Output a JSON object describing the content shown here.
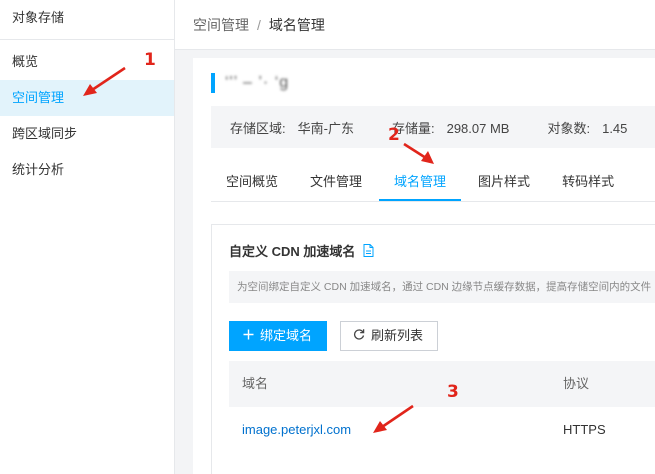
{
  "sidebar": {
    "title": "对象存储",
    "items": [
      {
        "label": "概览"
      },
      {
        "label": "空间管理"
      },
      {
        "label": "跨区域同步"
      },
      {
        "label": "统计分析"
      }
    ]
  },
  "breadcrumb": {
    "parent": "空间管理",
    "separator": "/",
    "current": "域名管理"
  },
  "bucket": {
    "name": "‘'’ – ’· ‘g"
  },
  "stats": {
    "region_label": "存储区域:",
    "region_value": "华南-广东",
    "storage_label": "存储量:",
    "storage_value": "298.07 MB",
    "objects_label": "对象数:",
    "objects_value": "1.45"
  },
  "tabs": [
    {
      "label": "空间概览"
    },
    {
      "label": "文件管理"
    },
    {
      "label": "域名管理"
    },
    {
      "label": "图片样式"
    },
    {
      "label": "转码样式"
    }
  ],
  "cdn": {
    "title": "自定义 CDN 加速域名",
    "tip": "为空间绑定自定义 CDN 加速域名，通过 CDN 边缘节点缓存数据，提高存储空间内的文件",
    "bind_button": "绑定域名",
    "refresh_button": "刷新列表",
    "table": {
      "headers": [
        "域名",
        "协议"
      ],
      "rows": [
        {
          "domain": "image.peterjxl.com",
          "protocol": "HTTPS"
        }
      ]
    }
  },
  "annotations": [
    "1",
    "2",
    "3"
  ],
  "colors": {
    "accent": "#00a4ff",
    "active_bg": "#e2f3fb",
    "annotation": "#e1251b",
    "link": "#0071ce"
  }
}
